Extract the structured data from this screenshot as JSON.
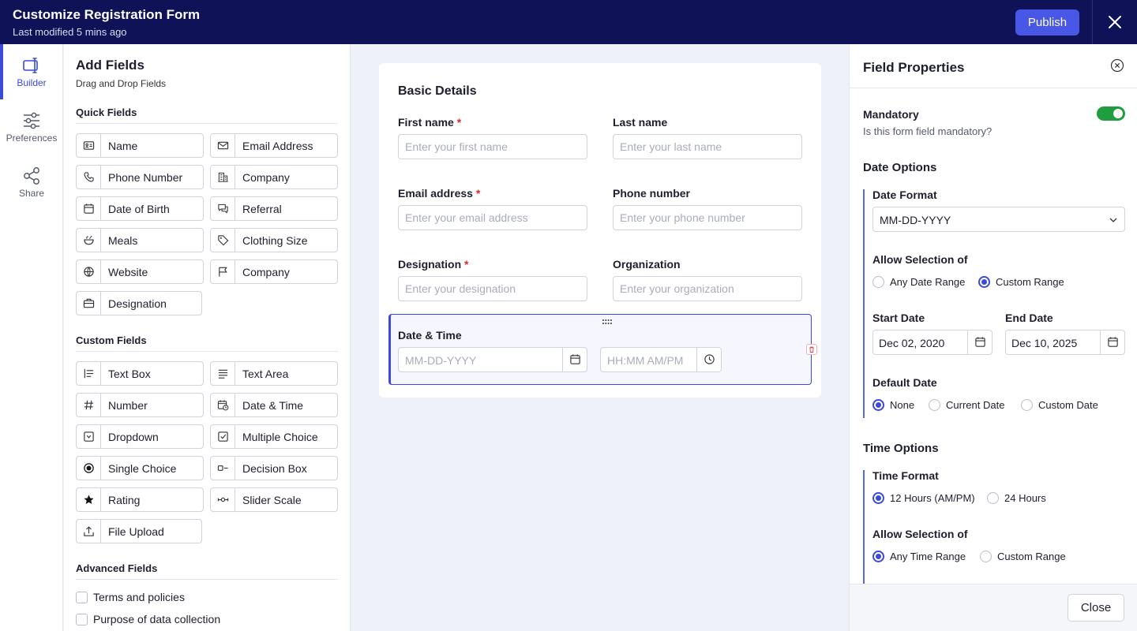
{
  "header": {
    "title": "Customize Registration Form",
    "subtitle": "Last modified 5 mins ago",
    "publish_label": "Publish"
  },
  "nav": {
    "items": [
      {
        "label": "Builder",
        "icon": "builder-icon",
        "active": true
      },
      {
        "label": "Preferences",
        "icon": "sliders-icon",
        "active": false
      },
      {
        "label": "Share",
        "icon": "share-icon",
        "active": false
      }
    ]
  },
  "fields_panel": {
    "title": "Add Fields",
    "subtitle": "Drag and Drop Fields",
    "quick_title": "Quick Fields",
    "quick": [
      {
        "label": "Name",
        "icon": "id-card-icon"
      },
      {
        "label": "Email Address",
        "icon": "envelope-icon"
      },
      {
        "label": "Phone Number",
        "icon": "phone-icon"
      },
      {
        "label": "Company",
        "icon": "building-icon"
      },
      {
        "label": "Date of Birth",
        "icon": "calendar-icon"
      },
      {
        "label": "Referral",
        "icon": "chat-icon"
      },
      {
        "label": "Meals",
        "icon": "bowl-icon"
      },
      {
        "label": "Clothing Size",
        "icon": "tag-icon"
      },
      {
        "label": "Website",
        "icon": "globe-icon"
      },
      {
        "label": "Company",
        "icon": "flag-icon"
      },
      {
        "label": "Designation",
        "icon": "briefcase-icon"
      }
    ],
    "custom_title": "Custom Fields",
    "custom": [
      {
        "label": "Text Box",
        "icon": "text-box-icon"
      },
      {
        "label": "Text Area",
        "icon": "text-area-icon"
      },
      {
        "label": "Number",
        "icon": "hash-icon"
      },
      {
        "label": "Date & Time",
        "icon": "calendar-clock-icon"
      },
      {
        "label": "Dropdown",
        "icon": "dropdown-icon"
      },
      {
        "label": "Multiple Choice",
        "icon": "checkbox-icon"
      },
      {
        "label": "Single Choice",
        "icon": "radio-icon"
      },
      {
        "label": "Decision Box",
        "icon": "decision-icon"
      },
      {
        "label": "Rating",
        "icon": "star-icon"
      },
      {
        "label": "Slider Scale",
        "icon": "slider-icon"
      },
      {
        "label": "File Upload",
        "icon": "upload-icon"
      }
    ],
    "advanced_title": "Advanced Fields",
    "advanced": [
      {
        "label": "Terms and policies"
      },
      {
        "label": "Purpose of data collection"
      }
    ]
  },
  "form": {
    "section_title": "Basic Details",
    "required_mark": "*",
    "fields": [
      {
        "label": "First name",
        "required": true,
        "placeholder": "Enter your first name"
      },
      {
        "label": "Last name",
        "required": false,
        "placeholder": "Enter your last name"
      },
      {
        "label": "Email address",
        "required": true,
        "placeholder": "Enter your email address"
      },
      {
        "label": "Phone number",
        "required": false,
        "placeholder": "Enter your phone number"
      },
      {
        "label": "Designation",
        "required": true,
        "placeholder": "Enter your designation"
      },
      {
        "label": "Organization",
        "required": false,
        "placeholder": "Enter your organization"
      }
    ],
    "datetime": {
      "label": "Date & Time",
      "date_placeholder": "MM-DD-YYYY",
      "time_placeholder": "HH:MM AM/PM"
    }
  },
  "properties": {
    "title": "Field Properties",
    "mandatory_label": "Mandatory",
    "mandatory_hint": "Is this form field mandatory?",
    "mandatory_on": true,
    "date_options_title": "Date Options",
    "date_format_label": "Date Format",
    "date_format_value": "MM-DD-YYYY",
    "allow_selection_label": "Allow Selection of",
    "date_range_options": [
      "Any Date Range",
      "Custom Range"
    ],
    "start_date_label": "Start Date",
    "start_date_value": "Dec 02, 2020",
    "end_date_label": "End Date",
    "end_date_value": "Dec 10, 2025",
    "default_date_label": "Default Date",
    "default_date_options": [
      "None",
      "Current Date",
      "Custom Date"
    ],
    "time_options_title": "Time Options",
    "time_format_label": "Time Format",
    "time_format_options": [
      "12 Hours (AM/PM)",
      "24 Hours"
    ],
    "time_allow_label": "Allow Selection of",
    "time_range_options": [
      "Any Time Range",
      "Custom Range"
    ],
    "close_label": "Close"
  },
  "colors": {
    "header_bg": "#0f1257",
    "accent": "#3b4ad8",
    "toggle_on": "#1f9d3f",
    "required": "#e0282b"
  }
}
